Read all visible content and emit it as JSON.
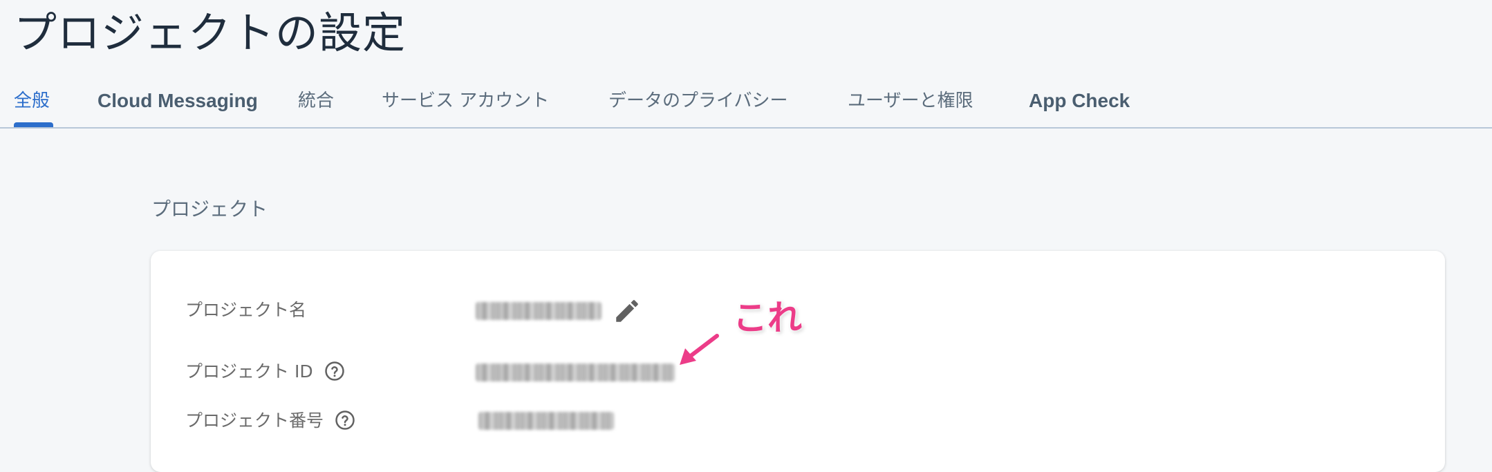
{
  "page": {
    "title": "プロジェクトの設定"
  },
  "tabs": [
    {
      "label": "全般",
      "active": true
    },
    {
      "label": "Cloud Messaging",
      "active": false
    },
    {
      "label": "統合",
      "active": false
    },
    {
      "label": "サービス アカウント",
      "active": false
    },
    {
      "label": "データのプライバシー",
      "active": false
    },
    {
      "label": "ユーザーと権限",
      "active": false
    },
    {
      "label": "App Check",
      "active": false
    }
  ],
  "project_section": {
    "heading": "プロジェクト",
    "fields": [
      {
        "label": "プロジェクト名",
        "value_redacted": true,
        "editable": true,
        "icon": "pencil-icon"
      },
      {
        "label": "プロジェクト ID",
        "value_redacted": true,
        "help_icon": "question-circle-icon"
      },
      {
        "label": "プロジェクト番号",
        "value_redacted": true,
        "help_icon": "question-circle-icon"
      }
    ]
  },
  "annotation": {
    "text": "これ",
    "color": "#ec3c88"
  },
  "colors": {
    "accent": "#2c6ecb",
    "background": "#f5f7f9",
    "card": "#ffffff"
  }
}
